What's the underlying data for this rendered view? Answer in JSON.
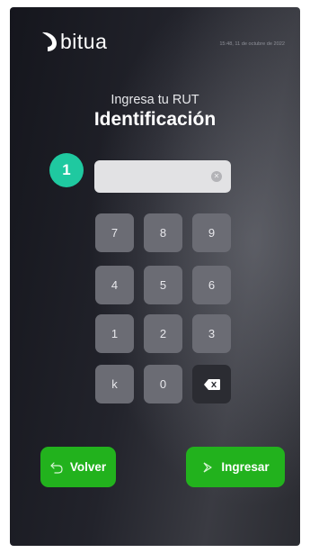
{
  "brand": {
    "name": "bitua"
  },
  "header": {
    "datetime": "15:48, 11 de octubre de 2022"
  },
  "form": {
    "subtitle": "Ingresa tu RUT",
    "title": "Identificación",
    "step_number": "1",
    "rut_value": ""
  },
  "keypad": {
    "keys": [
      "7",
      "8",
      "9",
      "4",
      "5",
      "6",
      "1",
      "2",
      "3",
      "k",
      "0"
    ]
  },
  "actions": {
    "back_label": "Volver",
    "enter_label": "Ingresar"
  },
  "colors": {
    "accent_green": "#22b21d",
    "step_badge": "#1fc9a0",
    "key_bg": "#6b6c74"
  },
  "icons": {
    "clear": "circle-x-icon",
    "backspace": "backspace-icon",
    "back": "undo-arrow-icon",
    "enter": "chevron-right-icon"
  }
}
